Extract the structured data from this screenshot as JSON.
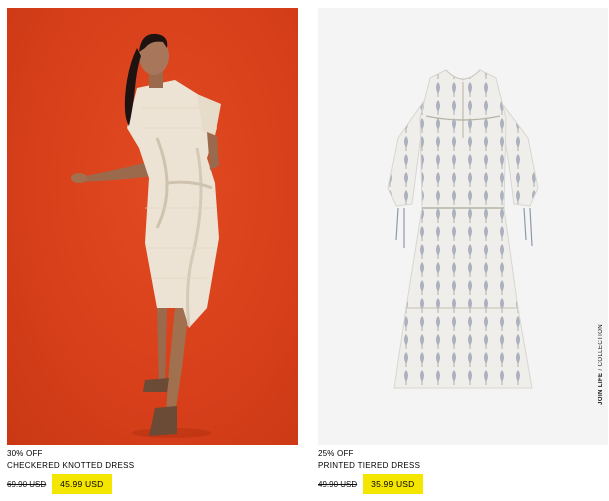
{
  "products": [
    {
      "discount": "30% OFF",
      "name": "CHECKERED KNOTTED DRESS",
      "old_price": "69.90 USD",
      "sale_price": "45.99 USD"
    },
    {
      "discount": "25% OFF",
      "name": "PRINTED TIERED DRESS",
      "old_price": "49.90 USD",
      "sale_price": "35.99 USD",
      "collection_tag_bold": "JOIN LIFE",
      "collection_tag_rest": "/ COLLECTION"
    }
  ],
  "colors": {
    "sale_highlight": "#f5e600",
    "photo_background_1": "#d8401b",
    "photo_background_2": "#f4f4f4"
  }
}
